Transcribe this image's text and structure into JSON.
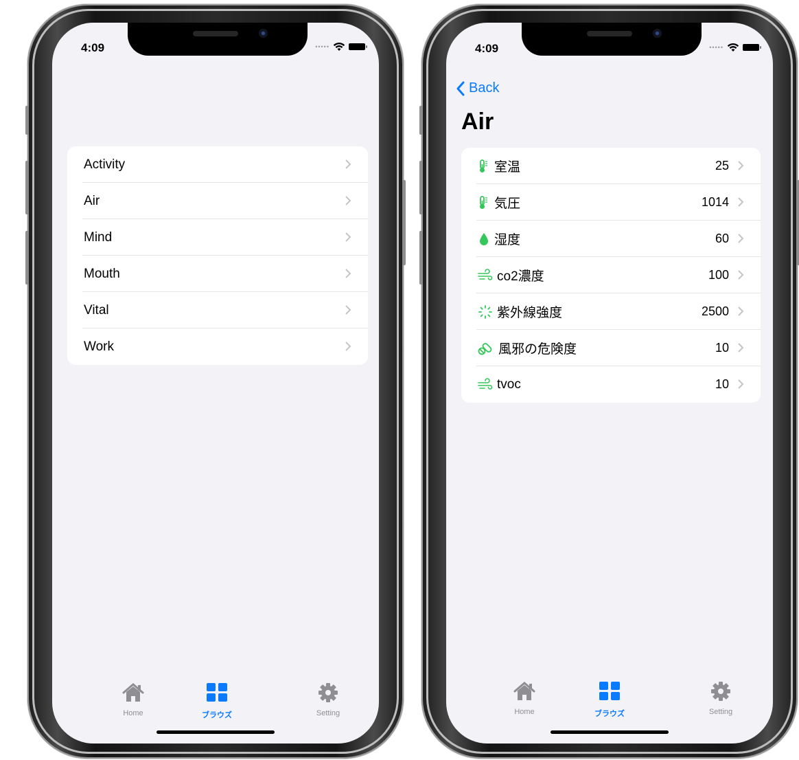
{
  "left_screen": {
    "status": {
      "time": "4:09"
    },
    "items": [
      "Activity",
      "Air",
      "Mind",
      "Mouth",
      "Vital",
      "Work"
    ],
    "tabs": [
      {
        "label": "Home",
        "icon": "house-icon"
      },
      {
        "label": "ブラウズ",
        "icon": "grid-icon",
        "active": true
      },
      {
        "label": "Setting",
        "icon": "gear-icon"
      }
    ]
  },
  "right_screen": {
    "status": {
      "time": "4:09"
    },
    "back_label": "Back",
    "title": "Air",
    "rows": [
      {
        "label": "室温",
        "value": "25",
        "icon": "thermometer-icon"
      },
      {
        "label": "気圧",
        "value": "1014",
        "icon": "thermometer-icon"
      },
      {
        "label": "湿度",
        "value": "60",
        "icon": "drop-icon"
      },
      {
        "label": "co2濃度",
        "value": "100",
        "icon": "wind-icon"
      },
      {
        "label": "紫外線強度",
        "value": "2500",
        "icon": "sparkle-icon"
      },
      {
        "label": "風邪の危険度",
        "value": "10",
        "icon": "pills-icon"
      },
      {
        "label": "tvoc",
        "value": "10",
        "icon": "wind-icon"
      }
    ],
    "tabs": [
      {
        "label": "Home",
        "icon": "house-icon"
      },
      {
        "label": "ブラウズ",
        "icon": "grid-icon",
        "active": true
      },
      {
        "label": "Setting",
        "icon": "gear-icon"
      }
    ]
  },
  "colors": {
    "accent": "#0a7aff",
    "icon_green": "#34c759",
    "background": "#f2f2f7",
    "chevron": "#c4c4c7"
  }
}
